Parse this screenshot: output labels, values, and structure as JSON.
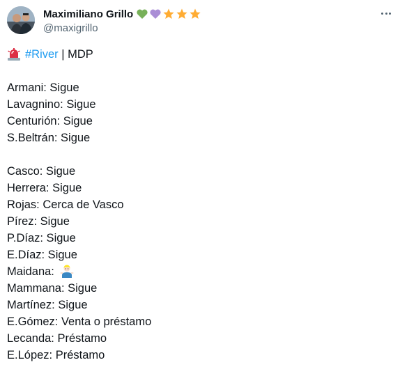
{
  "author": {
    "display_name": "Maximiliano Grillo",
    "handle": "@maxigrillo",
    "badges": [
      "green-heart-icon",
      "purple-heart-icon",
      "star-icon",
      "star-icon",
      "star-icon"
    ]
  },
  "tweet": {
    "headline": {
      "icon": "police-light-icon",
      "hashtag": "#River",
      "separator": " | MDP"
    },
    "group1": [
      "Armani: Sigue",
      "Lavagnino: Sigue",
      "Centurión: Sigue",
      "S.Beltrán: Sigue"
    ],
    "group2": [
      "Casco: Sigue",
      "Herrera: Sigue",
      "Rojas: Cerca de Vasco",
      "Pírez: Sigue",
      "P.Díaz: Sigue",
      "E.Díaz: Sigue",
      "Maidana: ",
      "Mammana: Sigue",
      "Martínez: Sigue",
      "E.Gómez: Venta o préstamo",
      "Lecanda: Préstamo",
      "E.López: Préstamo"
    ],
    "maidana_emoji": "person-shrugging-icon"
  },
  "colors": {
    "text": "#0f1419",
    "secondary": "#536471",
    "link": "#1d9bf0"
  }
}
